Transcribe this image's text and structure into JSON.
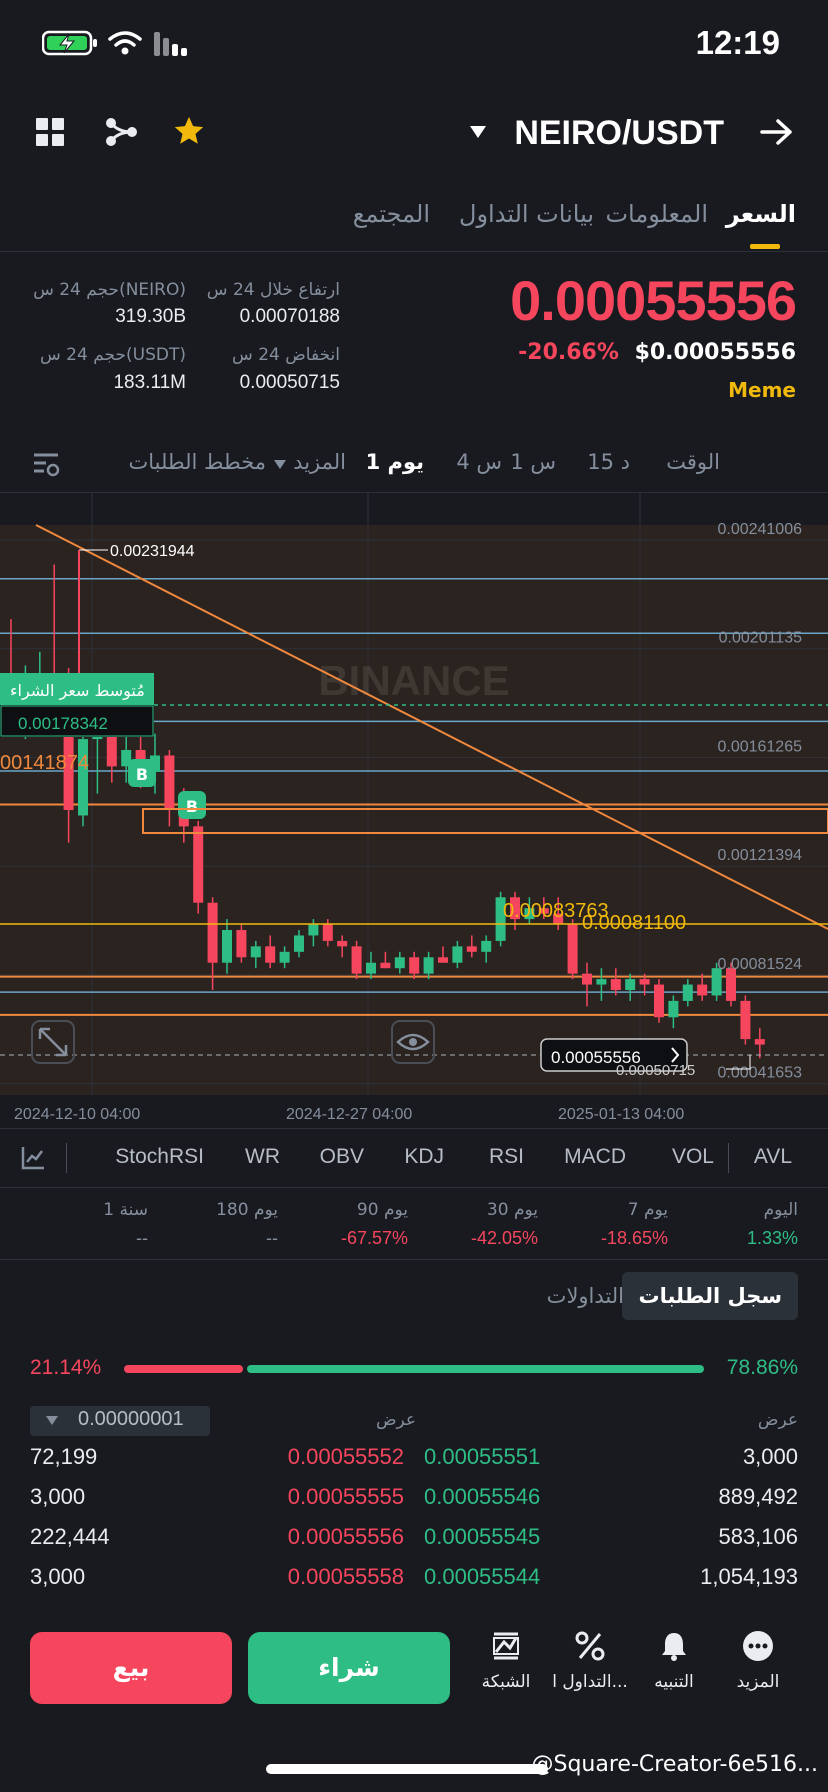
{
  "status_bar": {
    "time": "12:19"
  },
  "header": {
    "pair": "NEIRO/USDT"
  },
  "tabs": [
    {
      "label": "السعر",
      "active": true
    },
    {
      "label": "المعلومات",
      "active": false
    },
    {
      "label": "بيانات التداول",
      "active": false
    },
    {
      "label": "المجتمع",
      "active": false
    }
  ],
  "price": {
    "last": "0.00055556",
    "change_pct": "-20.66%",
    "usd": "$0.00055556",
    "tag": "Meme"
  },
  "stats": {
    "high_label": "ارتفاع خلال 24 س",
    "high_value": "0.00070188",
    "low_label": "انخفاض 24 س",
    "low_value": "0.00050715",
    "vol_base_label": "حجم 24 س(NEIRO)",
    "vol_base_value": "319.30B",
    "vol_quote_label": "حجم 24 س(USDT)",
    "vol_quote_value": "183.11M"
  },
  "timeframes": {
    "time": "الوقت",
    "m15": "15 د",
    "h1": "1 س",
    "h4": "4 س",
    "d1": "1 يوم",
    "more": "المزيد",
    "depth": "مخطط الطلبات"
  },
  "chart_data": {
    "type": "candlestick",
    "watermark": "BINANCE",
    "y_ticks": [
      "0.00241006",
      "0.00201135",
      "0.00161265",
      "0.00121394",
      "0.00081524",
      "0.00041653"
    ],
    "x_ticks": [
      "2024-12-10 04:00",
      "2024-12-27 04:00",
      "2025-01-13 04:00"
    ],
    "annotations": {
      "high_marker": "0.00231944",
      "left_level": "00141874",
      "avg_buy_label": "مُتوسط سعر الشراء",
      "avg_buy_value": "0.00178342",
      "level_a": "0.00083763",
      "level_b": "0.00081100",
      "current_price": "0.00055556",
      "low_marker": "0.00050715",
      "buy_marker": "B"
    },
    "candles": [
      {
        "o": 0.0019,
        "h": 0.00212,
        "l": 0.0017,
        "c": 0.00186
      },
      {
        "o": 0.00178,
        "h": 0.00195,
        "l": 0.00168,
        "c": 0.0019
      },
      {
        "o": 0.00186,
        "h": 0.002,
        "l": 0.00178,
        "c": 0.00192
      },
      {
        "o": 0.00192,
        "h": 0.00232,
        "l": 0.00182,
        "c": 0.00186
      },
      {
        "o": 0.00186,
        "h": 0.00194,
        "l": 0.0013,
        "c": 0.00142
      },
      {
        "o": 0.0014,
        "h": 0.00176,
        "l": 0.00136,
        "c": 0.00168
      },
      {
        "o": 0.00168,
        "h": 0.00186,
        "l": 0.00148,
        "c": 0.00176
      },
      {
        "o": 0.00176,
        "h": 0.00178,
        "l": 0.00152,
        "c": 0.00158
      },
      {
        "o": 0.00158,
        "h": 0.00182,
        "l": 0.00152,
        "c": 0.00164
      },
      {
        "o": 0.00164,
        "h": 0.0017,
        "l": 0.0015,
        "c": 0.00156
      },
      {
        "o": 0.00156,
        "h": 0.0017,
        "l": 0.00148,
        "c": 0.00162
      },
      {
        "o": 0.00162,
        "h": 0.00164,
        "l": 0.00136,
        "c": 0.00142
      },
      {
        "o": 0.00142,
        "h": 0.0015,
        "l": 0.0013,
        "c": 0.00136
      },
      {
        "o": 0.00136,
        "h": 0.00138,
        "l": 0.00104,
        "c": 0.00108
      },
      {
        "o": 0.00108,
        "h": 0.0011,
        "l": 0.00076,
        "c": 0.00086
      },
      {
        "o": 0.00086,
        "h": 0.00102,
        "l": 0.00082,
        "c": 0.00098
      },
      {
        "o": 0.00098,
        "h": 0.001,
        "l": 0.00086,
        "c": 0.00088
      },
      {
        "o": 0.00088,
        "h": 0.00094,
        "l": 0.00084,
        "c": 0.00092
      },
      {
        "o": 0.00092,
        "h": 0.00096,
        "l": 0.00084,
        "c": 0.00086
      },
      {
        "o": 0.00086,
        "h": 0.00092,
        "l": 0.00084,
        "c": 0.0009
      },
      {
        "o": 0.0009,
        "h": 0.00098,
        "l": 0.00088,
        "c": 0.00096
      },
      {
        "o": 0.00096,
        "h": 0.00102,
        "l": 0.00092,
        "c": 0.001
      },
      {
        "o": 0.001,
        "h": 0.00102,
        "l": 0.00092,
        "c": 0.00094
      },
      {
        "o": 0.00094,
        "h": 0.00096,
        "l": 0.00088,
        "c": 0.00092
      },
      {
        "o": 0.00092,
        "h": 0.00094,
        "l": 0.0008,
        "c": 0.00082
      },
      {
        "o": 0.00082,
        "h": 0.0009,
        "l": 0.0008,
        "c": 0.00086
      },
      {
        "o": 0.00086,
        "h": 0.0009,
        "l": 0.00084,
        "c": 0.00084
      },
      {
        "o": 0.00084,
        "h": 0.0009,
        "l": 0.00082,
        "c": 0.00088
      },
      {
        "o": 0.00088,
        "h": 0.0009,
        "l": 0.0008,
        "c": 0.00082
      },
      {
        "o": 0.00082,
        "h": 0.0009,
        "l": 0.0008,
        "c": 0.00088
      },
      {
        "o": 0.00088,
        "h": 0.00092,
        "l": 0.00086,
        "c": 0.00086
      },
      {
        "o": 0.00086,
        "h": 0.00094,
        "l": 0.00084,
        "c": 0.00092
      },
      {
        "o": 0.00092,
        "h": 0.00096,
        "l": 0.00088,
        "c": 0.0009
      },
      {
        "o": 0.0009,
        "h": 0.00096,
        "l": 0.00086,
        "c": 0.00094
      },
      {
        "o": 0.00094,
        "h": 0.00112,
        "l": 0.00092,
        "c": 0.0011
      },
      {
        "o": 0.0011,
        "h": 0.00112,
        "l": 0.00098,
        "c": 0.00102
      },
      {
        "o": 0.00102,
        "h": 0.0011,
        "l": 0.001,
        "c": 0.00106
      },
      {
        "o": 0.00106,
        "h": 0.0011,
        "l": 0.00102,
        "c": 0.00104
      },
      {
        "o": 0.00104,
        "h": 0.0011,
        "l": 0.00098,
        "c": 0.001
      },
      {
        "o": 0.001,
        "h": 0.00102,
        "l": 0.0008,
        "c": 0.00082
      },
      {
        "o": 0.00082,
        "h": 0.00086,
        "l": 0.0007,
        "c": 0.00078
      },
      {
        "o": 0.00078,
        "h": 0.00084,
        "l": 0.00072,
        "c": 0.0008
      },
      {
        "o": 0.0008,
        "h": 0.00084,
        "l": 0.00074,
        "c": 0.00076
      },
      {
        "o": 0.00076,
        "h": 0.00082,
        "l": 0.00072,
        "c": 0.0008
      },
      {
        "o": 0.0008,
        "h": 0.00082,
        "l": 0.00074,
        "c": 0.00078
      },
      {
        "o": 0.00078,
        "h": 0.0008,
        "l": 0.00064,
        "c": 0.00066
      },
      {
        "o": 0.00066,
        "h": 0.00074,
        "l": 0.00062,
        "c": 0.00072
      },
      {
        "o": 0.00072,
        "h": 0.0008,
        "l": 0.0007,
        "c": 0.00078
      },
      {
        "o": 0.00078,
        "h": 0.00082,
        "l": 0.00072,
        "c": 0.00074
      },
      {
        "o": 0.00074,
        "h": 0.00086,
        "l": 0.00072,
        "c": 0.00084
      },
      {
        "o": 0.00084,
        "h": 0.00086,
        "l": 0.0007,
        "c": 0.00072
      },
      {
        "o": 0.00072,
        "h": 0.00074,
        "l": 0.00056,
        "c": 0.00058
      },
      {
        "o": 0.00058,
        "h": 0.00062,
        "l": 0.00051,
        "c": 0.00056
      }
    ]
  },
  "indicators": [
    "AVL",
    "VOL",
    "MACD",
    "RSI",
    "KDJ",
    "OBV",
    "WR",
    "StochRSI"
  ],
  "performance": [
    {
      "label": "اليوم",
      "value": "1.33%",
      "dir": "up"
    },
    {
      "label": "7 يوم",
      "value": "-18.65%",
      "dir": "down"
    },
    {
      "label": "30 يوم",
      "value": "-42.05%",
      "dir": "down"
    },
    {
      "label": "90 يوم",
      "value": "-67.57%",
      "dir": "down"
    },
    {
      "label": "180 يوم",
      "value": "--",
      "dir": "none"
    },
    {
      "label": "1 سنة",
      "value": "--",
      "dir": "none"
    }
  ],
  "orderbook": {
    "tab_orders": "سجل الطلبات",
    "tab_trades": "التداولات",
    "buy_ratio": "78.86%",
    "sell_ratio": "21.14%",
    "buy_fraction": 0.7886,
    "bid_header": "عرض",
    "ask_header": "عرض",
    "precision": "0.00000001",
    "rows": [
      {
        "bid_qty": "3,000",
        "bid_price": "0.00055551",
        "ask_price": "0.00055552",
        "ask_qty": "72,199"
      },
      {
        "bid_qty": "889,492",
        "bid_price": "0.00055546",
        "ask_price": "0.00055555",
        "ask_qty": "3,000"
      },
      {
        "bid_qty": "583,106",
        "bid_price": "0.00055545",
        "ask_price": "0.00055556",
        "ask_qty": "222,444"
      },
      {
        "bid_qty": "1,054,193",
        "bid_price": "0.00055544",
        "ask_price": "0.00055558",
        "ask_qty": "3,000"
      }
    ]
  },
  "bottom_nav": {
    "buy": "شراء",
    "sell": "بيع",
    "grid": "الشبكة",
    "trading": "التداول ا...",
    "alert": "التنبيه",
    "more": "المزيد"
  },
  "watermark_credit": "@Square-Creator-6e516..."
}
